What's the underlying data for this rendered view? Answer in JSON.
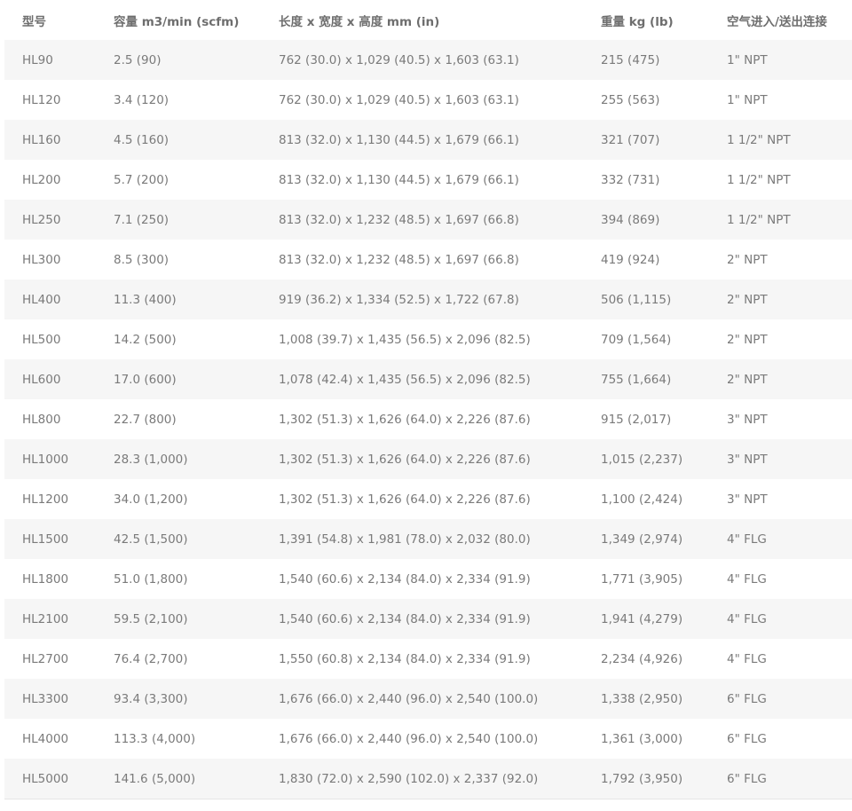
{
  "table": {
    "headers": [
      "型号",
      "容量 m3/min (scfm)",
      "长度 x 宽度 x 高度 mm (in)",
      "重量 kg (lb)",
      "空气进入/送出连接"
    ],
    "rows": [
      [
        "HL90",
        "2.5 (90)",
        "762 (30.0) x 1,029 (40.5) x 1,603 (63.1)",
        "215 (475)",
        "1\" NPT"
      ],
      [
        "HL120",
        "3.4 (120)",
        "762 (30.0) x 1,029 (40.5) x 1,603 (63.1)",
        "255 (563)",
        "1\" NPT"
      ],
      [
        "HL160",
        "4.5 (160)",
        "813 (32.0) x 1,130 (44.5) x 1,679 (66.1)",
        "321 (707)",
        "1 1/2\" NPT"
      ],
      [
        "HL200",
        "5.7 (200)",
        "813 (32.0) x 1,130 (44.5) x 1,679 (66.1)",
        "332 (731)",
        "1 1/2\" NPT"
      ],
      [
        "HL250",
        "7.1 (250)",
        "813 (32.0) x 1,232 (48.5) x 1,697 (66.8)",
        "394 (869)",
        "1 1/2\" NPT"
      ],
      [
        "HL300",
        "8.5 (300)",
        "813 (32.0) x 1,232 (48.5) x 1,697 (66.8)",
        "419 (924)",
        "2\" NPT"
      ],
      [
        "HL400",
        "11.3 (400)",
        "919 (36.2) x 1,334 (52.5) x 1,722 (67.8)",
        "506 (1,115)",
        "2\" NPT"
      ],
      [
        "HL500",
        "14.2 (500)",
        "1,008 (39.7) x 1,435 (56.5) x 2,096 (82.5)",
        "709 (1,564)",
        "2\" NPT"
      ],
      [
        "HL600",
        "17.0 (600)",
        "1,078 (42.4) x 1,435 (56.5) x 2,096 (82.5)",
        "755 (1,664)",
        "2\" NPT"
      ],
      [
        "HL800",
        "22.7 (800)",
        "1,302 (51.3) x 1,626 (64.0) x 2,226 (87.6)",
        "915 (2,017)",
        "3\" NPT"
      ],
      [
        "HL1000",
        "28.3 (1,000)",
        "1,302 (51.3) x 1,626 (64.0) x 2,226 (87.6)",
        "1,015 (2,237)",
        "3\" NPT"
      ],
      [
        "HL1200",
        "34.0 (1,200)",
        "1,302 (51.3) x 1,626 (64.0) x 2,226 (87.6)",
        "1,100 (2,424)",
        "3\" NPT"
      ],
      [
        "HL1500",
        "42.5 (1,500)",
        "1,391 (54.8) x 1,981 (78.0) x 2,032 (80.0)",
        "1,349 (2,974)",
        "4\" FLG"
      ],
      [
        "HL1800",
        "51.0 (1,800)",
        "1,540 (60.6) x 2,134 (84.0) x 2,334 (91.9)",
        "1,771 (3,905)",
        "4\" FLG"
      ],
      [
        "HL2100",
        "59.5 (2,100)",
        "1,540 (60.6) x 2,134 (84.0) x 2,334 (91.9)",
        "1,941 (4,279)",
        "4\" FLG"
      ],
      [
        "HL2700",
        "76.4 (2,700)",
        "1,550 (60.8) x 2,134 (84.0) x 2,334 (91.9)",
        "2,234 (4,926)",
        "4\" FLG"
      ],
      [
        "HL3300",
        "93.4 (3,300)",
        "1,676 (66.0) x 2,440 (96.0) x 2,540 (100.0)",
        "1,338 (2,950)",
        "6\" FLG"
      ],
      [
        "HL4000",
        "113.3 (4,000)",
        "1,676 (66.0) x 2,440 (96.0) x 2,540 (100.0)",
        "1,361 (3,000)",
        "6\" FLG"
      ],
      [
        "HL5000",
        "141.6 (5,000)",
        "1,830 (72.0) x 2,590 (102.0) x 2,337 (92.0)",
        "1,792 (3,950)",
        "6\" FLG"
      ]
    ]
  }
}
